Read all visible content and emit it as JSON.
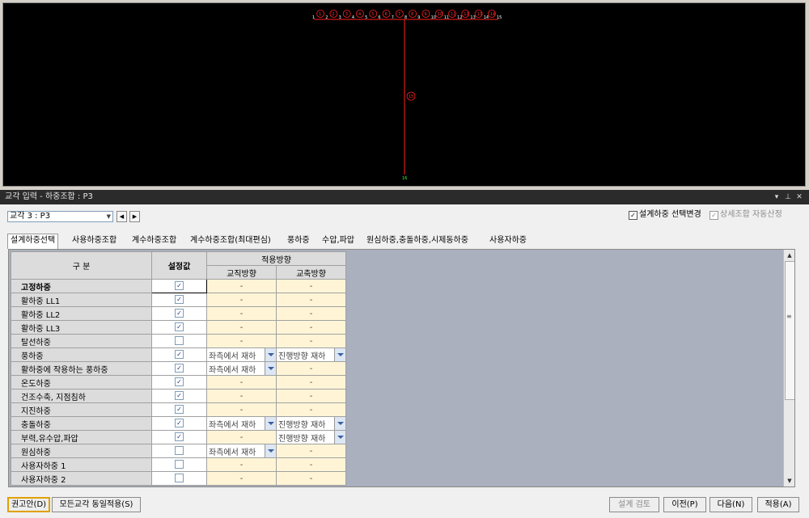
{
  "viewport": {
    "top_nodes": [
      "1",
      "2",
      "3",
      "4",
      "5",
      "6",
      "7",
      "8",
      "9",
      "10",
      "11",
      "12",
      "13",
      "14",
      "15"
    ],
    "top_elements": [
      "1",
      "2",
      "3",
      "4",
      "5",
      "6",
      "7",
      "8",
      "9",
      "10",
      "11",
      "12",
      "13",
      "14"
    ],
    "pier_bottom_node": "16",
    "pier_element": "15"
  },
  "panel": {
    "title": "교각 입력 - 하중조합 : P3",
    "pin_icon": "pin-icon",
    "close_icon": "close-icon"
  },
  "toolbar": {
    "pier_select": "교각 3 : P3",
    "opt_design_load_change": "설계하중 선택변경",
    "opt_detail_auto": "상세조합 자동산정",
    "opt_design_load_checked": true,
    "opt_detail_auto_checked": true
  },
  "tabs": [
    "설계하중선택",
    "사용하중조합",
    "계수하중조합",
    "계수하중조합(최대편심)",
    "풍하중",
    "수압,파압",
    "원심하중,충돌하중,시제동하중",
    "사용자하중"
  ],
  "grid": {
    "header_category": "구 분",
    "header_value": "설정값",
    "header_apply_direction": "적용방향",
    "header_perp": "교직방향",
    "header_axis": "교축방향",
    "rows": [
      {
        "name": "고정하중",
        "bold": true,
        "checked": true,
        "perp": "-",
        "axis": "-",
        "perp_combo": false,
        "axis_combo": false
      },
      {
        "name": "활하중  LL1",
        "bold": false,
        "checked": true,
        "perp": "-",
        "axis": "-",
        "perp_combo": false,
        "axis_combo": false
      },
      {
        "name": "활하중  LL2",
        "bold": false,
        "checked": true,
        "perp": "-",
        "axis": "-",
        "perp_combo": false,
        "axis_combo": false
      },
      {
        "name": "활하중  LL3",
        "bold": false,
        "checked": true,
        "perp": "-",
        "axis": "-",
        "perp_combo": false,
        "axis_combo": false
      },
      {
        "name": "탈선하중",
        "bold": false,
        "checked": false,
        "perp": "-",
        "axis": "-",
        "perp_combo": false,
        "axis_combo": false
      },
      {
        "name": "풍하중",
        "bold": false,
        "checked": true,
        "perp": "좌측에서 재하",
        "axis": "진행방향 재하",
        "perp_combo": true,
        "axis_combo": true
      },
      {
        "name": "활하중에 작용하는 풍하중",
        "bold": false,
        "checked": true,
        "perp": "좌측에서 재하",
        "axis": "-",
        "perp_combo": true,
        "axis_combo": false
      },
      {
        "name": "온도하중",
        "bold": false,
        "checked": true,
        "perp": "-",
        "axis": "-",
        "perp_combo": false,
        "axis_combo": false
      },
      {
        "name": "건조수축, 지점침하",
        "bold": false,
        "checked": true,
        "perp": "-",
        "axis": "-",
        "perp_combo": false,
        "axis_combo": false
      },
      {
        "name": "지진하중",
        "bold": false,
        "checked": true,
        "perp": "-",
        "axis": "-",
        "perp_combo": false,
        "axis_combo": false
      },
      {
        "name": "충돌하중",
        "bold": false,
        "checked": true,
        "perp": "좌측에서 재하",
        "axis": "진행방향 재하",
        "perp_combo": true,
        "axis_combo": true
      },
      {
        "name": "부력,유수압,파압",
        "bold": false,
        "checked": true,
        "perp": "-",
        "axis": "진행방향 재하",
        "perp_combo": false,
        "axis_combo": true
      },
      {
        "name": "원심하중",
        "bold": false,
        "checked": false,
        "perp": "좌측에서 재하",
        "axis": "-",
        "perp_combo": true,
        "axis_combo": false
      },
      {
        "name": "사용자하중 1",
        "bold": false,
        "checked": false,
        "perp": "-",
        "axis": "-",
        "perp_combo": false,
        "axis_combo": false
      },
      {
        "name": "사용자하중 2",
        "bold": false,
        "checked": false,
        "perp": "-",
        "axis": "-",
        "perp_combo": false,
        "axis_combo": false
      }
    ]
  },
  "buttons": {
    "recommend": "권고안(D)",
    "apply_all_piers": "모든교각 동일적용(S)",
    "design_check": "설계 검토",
    "prev": "이전(P)",
    "next": "다음(N)",
    "apply": "적용(A)"
  },
  "colors": {
    "viewport_bg": "#000000",
    "member": "#ff2020",
    "node_label": "#ffffff",
    "grid_bg": "#aab0bd",
    "direction_cell": "#fff5d6"
  }
}
